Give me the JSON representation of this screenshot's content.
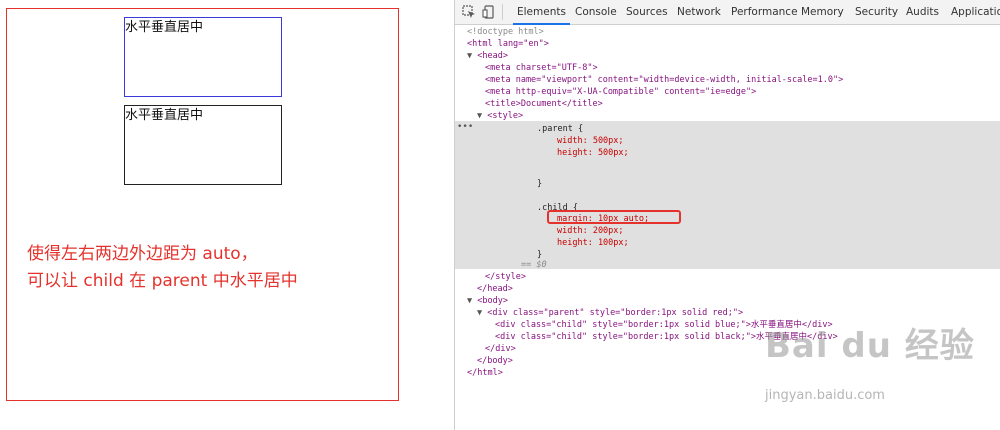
{
  "viewport": {
    "child1_text": "水平垂直居中",
    "child2_text": "水平垂直居中",
    "note_line1": "使得左右两边外边距为 auto，",
    "note_line2": "可以让 child 在 parent 中水平居中",
    "colors": {
      "parent_border": "#e5322d",
      "child1_border": "#3b3bdc",
      "child2_border": "#222222",
      "note": "#e5322d"
    }
  },
  "devtools": {
    "tabs": [
      "Elements",
      "Console",
      "Sources",
      "Network",
      "Performance",
      "Memory",
      "Security",
      "Audits",
      "Application"
    ],
    "active_tab": "Elements",
    "tree": {
      "doctype": "<!doctype html>",
      "html_open": "<html lang=\"en\">",
      "head_open": "<head>",
      "meta_charset": "<meta charset=\"UTF-8\">",
      "meta_viewport": "<meta name=\"viewport\" content=\"width=device-width, initial-scale=1.0\">",
      "meta_http": "<meta http-equiv=\"X-UA-Compatible\" content=\"ie=edge\">",
      "title": "<title>Document</title>",
      "style_open": "<style>",
      "css_parent_sel": ".parent {",
      "css_width1": "width: 500px;",
      "css_height1": "height: 500px;",
      "css_close1": "}",
      "css_child_sel": ".child {",
      "css_margin": "margin: 10px auto;",
      "css_width2": "width: 200px;",
      "css_height2": "height: 100px;",
      "css_close2": "}",
      "eq_ref": "== $0",
      "style_close": "</style>",
      "head_close": "</head>",
      "body_open": "<body>",
      "div_parent": "<div class=\"parent\" style=\"border:1px solid red;\">",
      "div_child1": "<div class=\"child\" style=\"border:1px solid blue;\">水平垂直居中</div>",
      "div_child2": "<div class=\"child\" style=\"border:1px solid black;\">水平垂直居中</div>",
      "div_close": "</div>",
      "body_close": "</body>",
      "html_close": "</html>"
    }
  },
  "watermark": {
    "logo": "Bai du 经验",
    "url": "jingyan.baidu.com"
  }
}
